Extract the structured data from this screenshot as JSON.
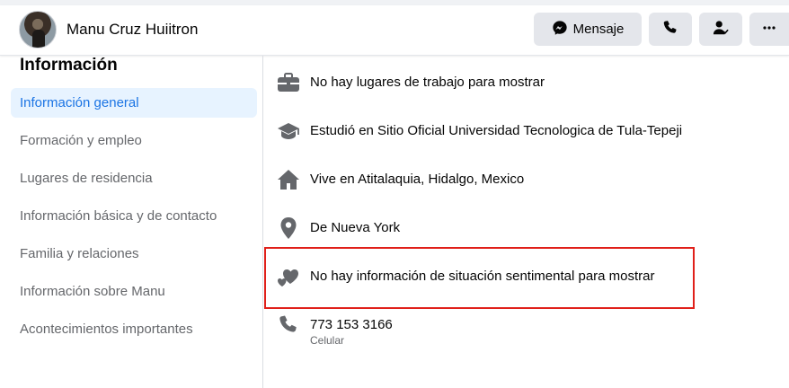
{
  "header": {
    "name": "Manu Cruz Huiitron",
    "message_label": "Mensaje"
  },
  "sidebar": {
    "title": "Información",
    "items": [
      {
        "label": "Información general",
        "active": true
      },
      {
        "label": "Formación y empleo"
      },
      {
        "label": "Lugares de residencia"
      },
      {
        "label": "Información básica y de contacto"
      },
      {
        "label": "Familia y relaciones"
      },
      {
        "label": "Información sobre Manu"
      },
      {
        "label": "Acontecimientos importantes"
      }
    ]
  },
  "overview": {
    "work": "No hay lugares de trabajo para mostrar",
    "education": "Estudió en Sitio Oficial Universidad Tecnologica de Tula-Tepeji",
    "lives": "Vive en Atitalaquia, Hidalgo, Mexico",
    "from": "De Nueva York",
    "relationship": "No hay información de situación sentimental para mostrar",
    "phone": "773 153 3166",
    "phone_type": "Celular"
  },
  "icons": {
    "messenger": "messenger-icon",
    "call": "phone-icon",
    "friend": "friend-status-icon",
    "more": "more-dots-icon",
    "work": "briefcase-icon",
    "education": "graduation-cap-icon",
    "home": "home-icon",
    "location": "location-pin-icon",
    "relationship": "hearts-icon",
    "phone": "phone-icon"
  },
  "colors": {
    "accent": "#1b74e4",
    "active_bg": "#e7f3ff",
    "highlight_border": "#e0201a",
    "icon_gray": "#65676b"
  }
}
